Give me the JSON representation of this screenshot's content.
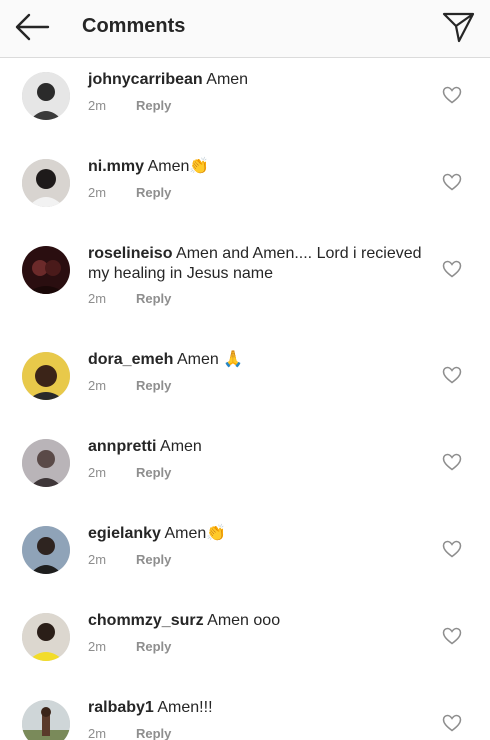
{
  "header": {
    "title": "Comments"
  },
  "comments": [
    {
      "username": "johnycarribean",
      "text": "Amen",
      "time": "2m",
      "reply": "Reply"
    },
    {
      "username": "ni.mmy",
      "text": "Amen👏",
      "time": "2m",
      "reply": "Reply"
    },
    {
      "username": "roselineiso",
      "text": "Amen and Amen.... Lord i recieved my healing in Jesus name",
      "time": "2m",
      "reply": "Reply"
    },
    {
      "username": "dora_emeh",
      "text": "Amen 🙏",
      "time": "2m",
      "reply": "Reply"
    },
    {
      "username": "annpretti",
      "text": "Amen",
      "time": "2m",
      "reply": "Reply"
    },
    {
      "username": "egielanky",
      "text": "Amen👏",
      "time": "2m",
      "reply": "Reply"
    },
    {
      "username": "chommzy_surz",
      "text": "Amen ooo",
      "time": "2m",
      "reply": "Reply"
    },
    {
      "username": "ralbaby1",
      "text": "Amen!!!",
      "time": "2m",
      "reply": "Reply"
    }
  ],
  "icons": {
    "back": "back-arrow-icon",
    "send": "direct-send-icon",
    "like": "heart-outline-icon"
  },
  "colors": {
    "text": "#262626",
    "secondary": "#8e8e8e",
    "header_bg": "#fafafa",
    "divider": "#dbdbdb"
  }
}
